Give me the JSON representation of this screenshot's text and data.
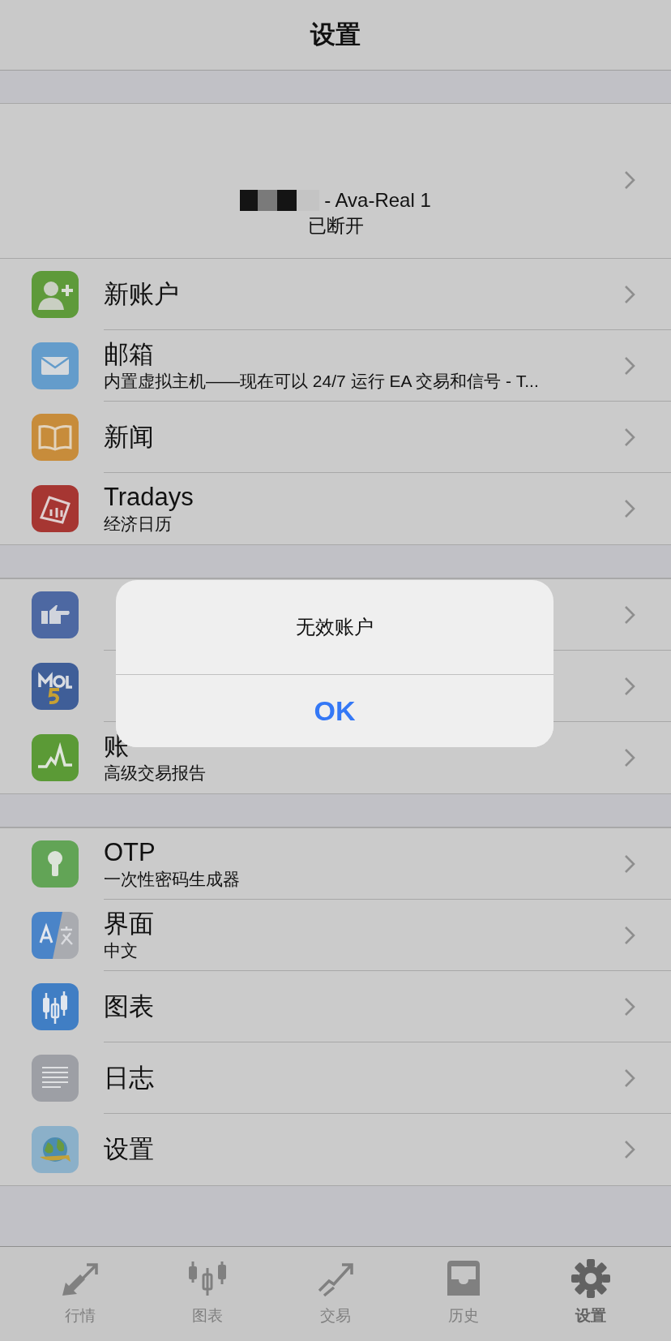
{
  "header": {
    "title": "设置"
  },
  "account": {
    "server": "- Ava-Real 1",
    "status": "已断开"
  },
  "sections": [
    {
      "rows": [
        {
          "kind": "text",
          "title": "新账户"
        },
        {
          "kind": "text",
          "title": "邮箱",
          "subtitle": "内置虚拟主机——现在可以 24/7 运行 EA 交易和信号 - T..."
        },
        {
          "kind": "text",
          "title": "新闻"
        },
        {
          "kind": "text",
          "title": "Tradays",
          "subtitle": "经济日历"
        }
      ]
    },
    {
      "rows": [
        {
          "kind": "covered"
        },
        {
          "kind": "covered"
        },
        {
          "kind": "text",
          "title": "账",
          "subtitle": "高级交易报告"
        }
      ]
    },
    {
      "rows": [
        {
          "kind": "text",
          "title": "OTP",
          "subtitle": "一次性密码生成器"
        },
        {
          "kind": "text",
          "title": "界面",
          "subtitle": "中文"
        },
        {
          "kind": "text",
          "title": "图表"
        },
        {
          "kind": "text",
          "title": "日志"
        },
        {
          "kind": "text",
          "title": "设置"
        }
      ]
    }
  ],
  "dialog": {
    "message": "无效账户",
    "button": "OK"
  },
  "tabs": [
    {
      "label": "行情",
      "selected": false
    },
    {
      "label": "图表",
      "selected": false
    },
    {
      "label": "交易",
      "selected": false
    },
    {
      "label": "历史",
      "selected": false
    },
    {
      "label": "设置",
      "selected": true
    }
  ]
}
